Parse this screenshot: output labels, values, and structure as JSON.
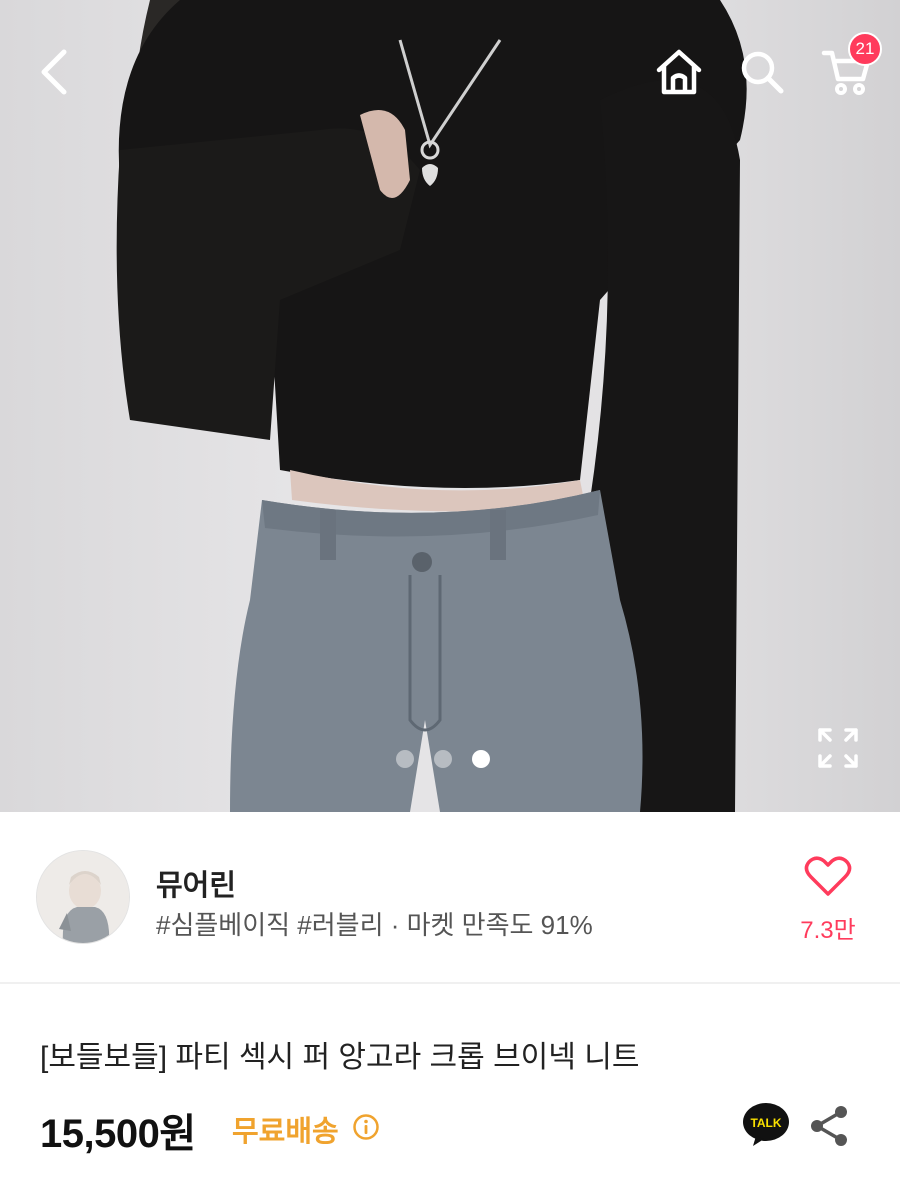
{
  "header": {
    "back_icon": "chevron-left-icon",
    "home_icon": "home-icon",
    "search_icon": "search-icon",
    "cart_icon": "cart-icon",
    "cart_count": "21"
  },
  "gallery": {
    "image_count": 3,
    "active_index": 2,
    "expand_icon": "expand-icon"
  },
  "shop": {
    "name": "뮤어린",
    "tags": "#심플베이직 #러블리 · 마켓 만족도 91%",
    "like_count": "7.3만"
  },
  "product": {
    "title": "[보들보들] 파티 섹시 퍼 앙고라 크롭 브이넥 니트",
    "price": "15,500원",
    "shipping": "무료배송"
  },
  "colors": {
    "accent_red": "#ff3b5c",
    "shipping_orange": "#f0a32e",
    "talk_yellow": "#f9e000"
  }
}
